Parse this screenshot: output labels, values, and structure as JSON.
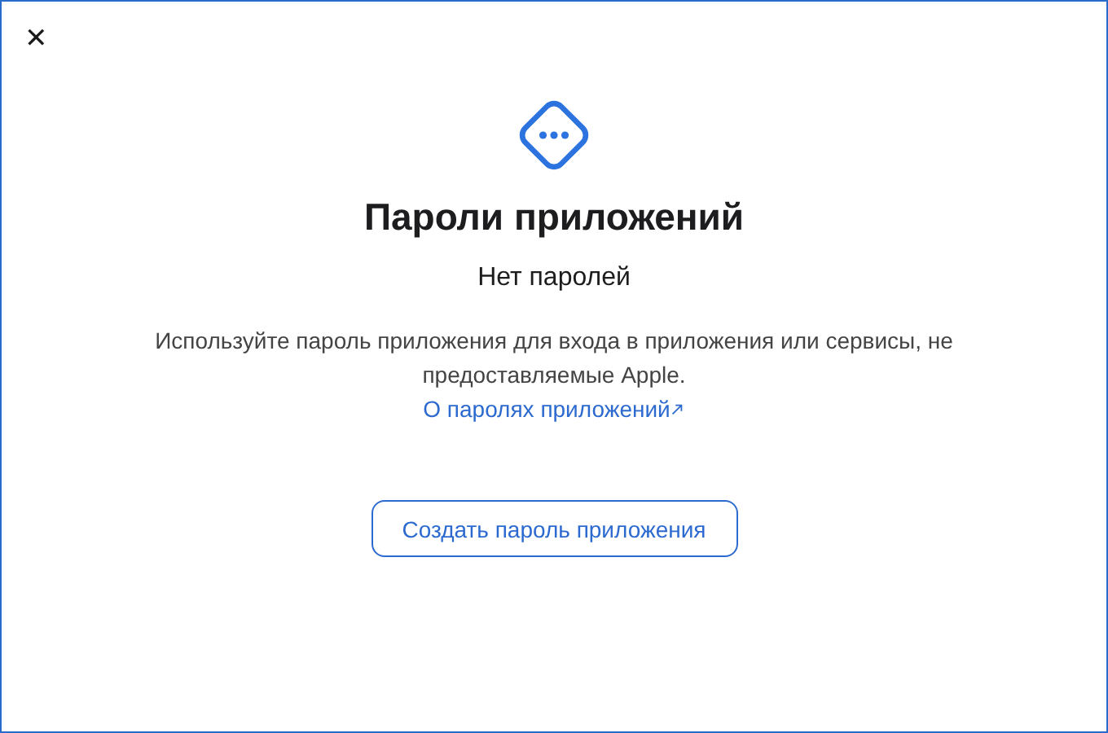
{
  "close_button": {
    "label": "✕"
  },
  "title": "Пароли приложений",
  "subtitle": "Нет паролей",
  "description": "Используйте пароль приложения для входа в приложения или сервисы, не предоставляемые Apple.",
  "link": {
    "label": "О паролях приложений"
  },
  "buttons": [
    {
      "label": "Создать пароль приложения"
    }
  ]
}
